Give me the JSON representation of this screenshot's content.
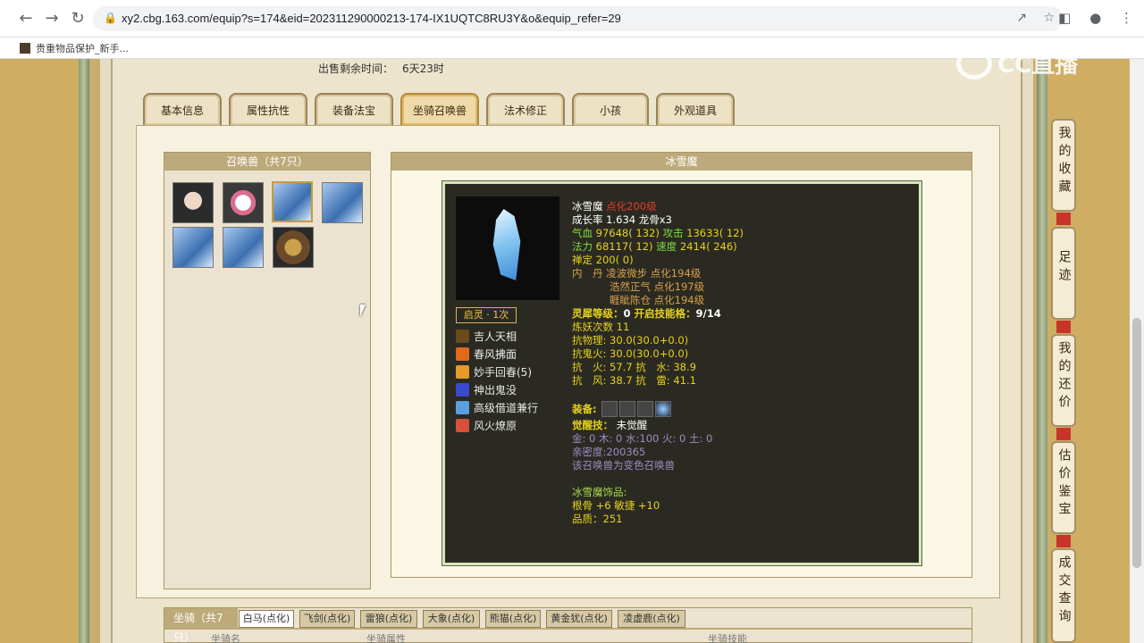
{
  "browser": {
    "url": "xy2.cbg.163.com/equip?s=174&eid=202311290000213-174-IX1UQTC8RU3Y&o&equip_refer=29",
    "bookmark": "贵重物品保护_新手..."
  },
  "sale": {
    "label": "出售剩余时间：",
    "value": "6天23时"
  },
  "tabs": [
    "基本信息",
    "属性抗性",
    "装备法宝",
    "坐骑召唤兽",
    "法术修正",
    "小孩",
    "外观道具"
  ],
  "active_tab": "坐骑召唤兽",
  "summon_list": {
    "title": "召唤兽（共7只）"
  },
  "pet_panel": {
    "title": "冰雪魔",
    "spirit_badge": "启灵 · 1次",
    "skills": [
      "吉人天相",
      "春风拂面",
      "妙手回春(5)",
      "神出鬼没",
      "高级借道兼行",
      "风火燎原"
    ],
    "name": "冰雪魔",
    "level": "点化200级",
    "growth": "成长率 1.634 龙骨x3",
    "hp_label": "气血",
    "hp": "97648( 132)",
    "atk_label": "攻击",
    "atk": "13633( 12)",
    "mp_label": "法力",
    "mp": "68117( 12)",
    "spd_label": "速度",
    "spd": "2414( 246)",
    "zen": "禅定 200( 0)",
    "inner_label": "内　丹",
    "inner": [
      "凌波微步 点化194级",
      "浩然正气 点化197级",
      "睚眦陈仓 点化194级"
    ],
    "soul_label": "灵犀等级：",
    "soul": "0",
    "skill_slot_label": "开启技能格：",
    "skill_slot": "9/14",
    "refine": "炼妖次数 11",
    "resist_phys": "抗物理: 30.0(30.0+0.0)",
    "resist_ghost": "抗鬼火: 30.0(30.0+0.0)",
    "resist_fire": "抗　火: 57.7 抗　水: 38.9",
    "resist_wind": "抗　风: 38.7 抗　雷: 41.1",
    "equip_label": "装备:",
    "awaken_label": "觉醒技：",
    "awaken": "未觉醒",
    "elements": "金: 0 木: 0 水:100 火: 0 土: 0",
    "intimacy": "亲密度:200365",
    "variant": "该召唤兽为变色召唤兽",
    "ornament_title": "冰雪魔饰品:",
    "ornament_stats": "根骨 +6 敏捷 +10",
    "ornament_quality": "品质：251"
  },
  "mounts": {
    "title": "坐骑（共7只）",
    "tabs": [
      "白马(点化)",
      "飞剑(点化)",
      "雷狼(点化)",
      "大象(点化)",
      "熊猫(点化)",
      "黄金犹(点化)",
      "凌虚鹿(点化)"
    ],
    "columns": [
      "坐骑名",
      "坐骑属性",
      "坐骑技能"
    ]
  },
  "side_buttons": [
    "我的收藏",
    "足迹",
    "我的还价",
    "估价鉴宝",
    "成交查询"
  ],
  "watermark": "CC直播"
}
